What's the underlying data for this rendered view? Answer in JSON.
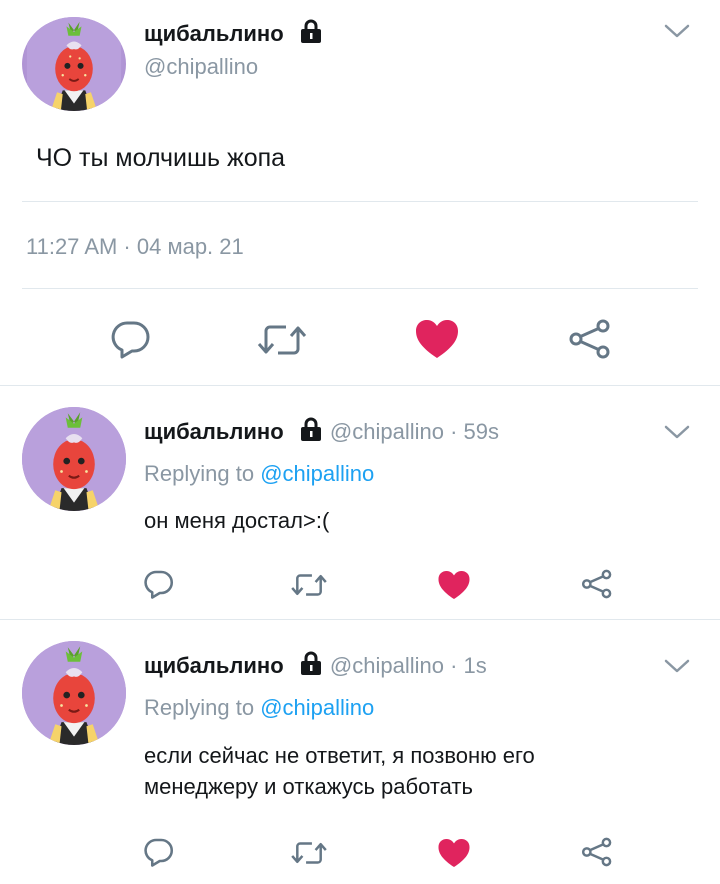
{
  "main_tweet": {
    "display_name": "щибальлино",
    "handle": "@chipallino",
    "text": "ЧО ты молчишь жопа",
    "timestamp": "11:27 AM · 04 мар. 21"
  },
  "replies": [
    {
      "display_name": "щибальлино",
      "handle_time": "@chipallino · 59s",
      "replying_prefix": "Replying to",
      "replying_to": "@chipallino",
      "text": "он меня достал>:("
    },
    {
      "display_name": "щибальлино",
      "handle_time": "@chipallino · 1s",
      "replying_prefix": "Replying to",
      "replying_to": "@chipallino",
      "text_line1": "если сейчас не ответит, я позвоню его",
      "text_line2": "менеджеру и откажусь работать"
    }
  ],
  "icons": {
    "reply": "reply-icon",
    "retweet": "retweet-icon",
    "like": "heart-icon",
    "share": "share-icon",
    "lock": "lock-icon",
    "menu": "chevron-down-icon"
  },
  "colors": {
    "like": "#e0245e",
    "link": "#1da1f2",
    "muted": "#8a97a3",
    "text": "#14171a",
    "icon": "#657786"
  }
}
